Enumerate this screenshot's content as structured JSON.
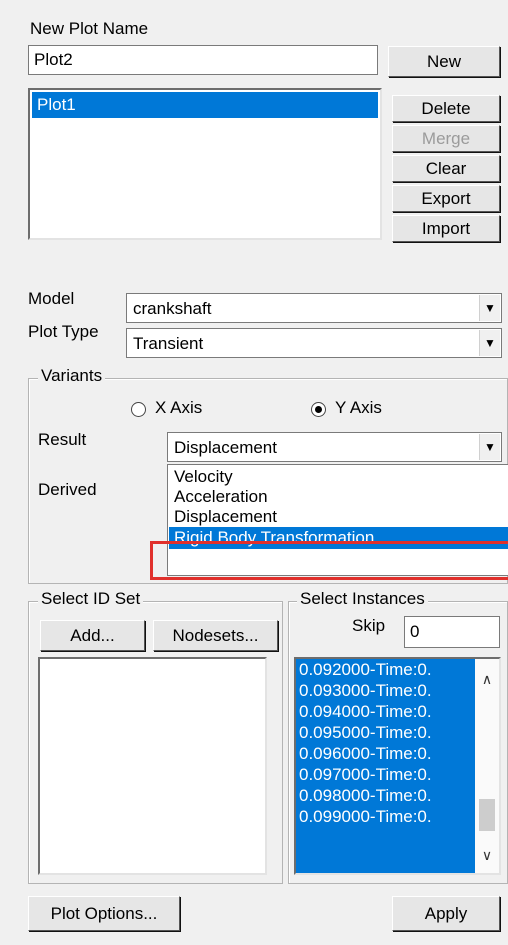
{
  "new_plot": {
    "label": "New Plot Name",
    "value": "Plot2",
    "new_button": "New"
  },
  "plots_list": {
    "items": [
      "Plot1"
    ],
    "selected": "Plot1"
  },
  "plot_buttons": {
    "delete": "Delete",
    "merge": "Merge",
    "clear": "Clear",
    "export": "Export",
    "import": "Import"
  },
  "model": {
    "label": "Model",
    "value": "crankshaft"
  },
  "plot_type": {
    "label": "Plot Type",
    "value": "Transient"
  },
  "variants": {
    "legend": "Variants",
    "x_axis": "X Axis",
    "y_axis": "Y Axis",
    "selected_axis": "Y Axis",
    "result_label": "Result",
    "result_value": "Displacement",
    "derived_label": "Derived",
    "dropdown_options": [
      "Velocity",
      "Acceleration",
      "Displacement",
      "Rigid Body Transformation"
    ],
    "highlighted_option": "Rigid Body Transformation",
    "highlight_box_color": "#e0302c"
  },
  "select_id_set": {
    "legend": "Select ID Set",
    "add_button": "Add...",
    "nodesets_button": "Nodesets..."
  },
  "select_instances": {
    "legend": "Select Instances",
    "skip_label": "Skip",
    "skip_value": "0",
    "items": [
      "0.092000-Time:0.",
      "0.093000-Time:0.",
      "0.094000-Time:0.",
      "0.095000-Time:0.",
      "0.096000-Time:0.",
      "0.097000-Time:0.",
      "0.098000-Time:0.",
      "0.099000-Time:0."
    ]
  },
  "footer": {
    "plot_options_button": "Plot Options...",
    "apply_button": "Apply"
  },
  "colors": {
    "selection": "#0078d7",
    "panel": "#f0f0f0"
  },
  "icons": {
    "dropdown": "chevron-down-icon",
    "scroll_up": "chevron-up-icon",
    "scroll_down": "chevron-down-icon"
  }
}
